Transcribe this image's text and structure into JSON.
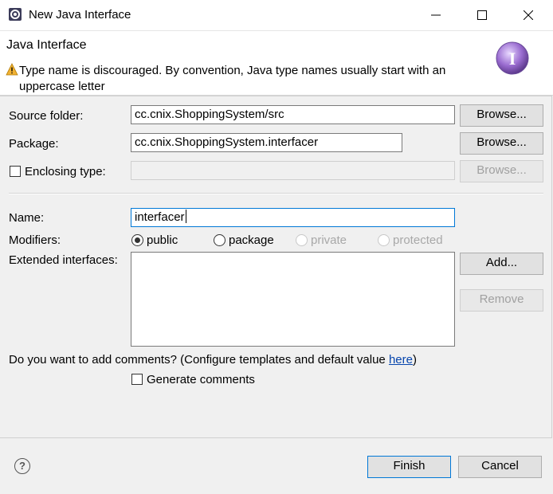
{
  "window": {
    "title": "New Java Interface",
    "icons": {
      "app": "eclipse-gear-icon",
      "minimize": "minimize-icon",
      "maximize": "maximize-icon",
      "close": "close-icon"
    }
  },
  "header": {
    "title": "Java Interface",
    "warning_text": "Type name is discouraged. By convention, Java type names usually start with an uppercase letter",
    "warning_icon": "warning-icon",
    "banner_icon": "interface-wizard-icon"
  },
  "form": {
    "source_folder": {
      "label": "Source folder:",
      "value": "cc.cnix.ShoppingSystem/src",
      "browse": "Browse..."
    },
    "package": {
      "label": "Package:",
      "value": "cc.cnix.ShoppingSystem.interfacer",
      "browse": "Browse..."
    },
    "enclosing_type": {
      "label": "Enclosing type:",
      "value": "",
      "browse": "Browse...",
      "checked": false
    },
    "name": {
      "label": "Name:",
      "value": "interfacer"
    },
    "modifiers": {
      "label": "Modifiers:",
      "options": [
        "public",
        "package",
        "private",
        "protected"
      ],
      "selected": "public"
    },
    "extended_interfaces": {
      "label": "Extended interfaces:",
      "add": "Add...",
      "remove": "Remove",
      "items": []
    },
    "comments": {
      "question": "Do you want to add comments? (Configure templates and default value ",
      "link": "here",
      "question_end": ")",
      "generate_label": "Generate comments",
      "checked": false
    }
  },
  "footer": {
    "help_icon": "help-icon",
    "finish": "Finish",
    "cancel": "Cancel"
  },
  "colors": {
    "accent": "#0078d7",
    "link": "#0645ad",
    "warning": "#f2b233"
  }
}
